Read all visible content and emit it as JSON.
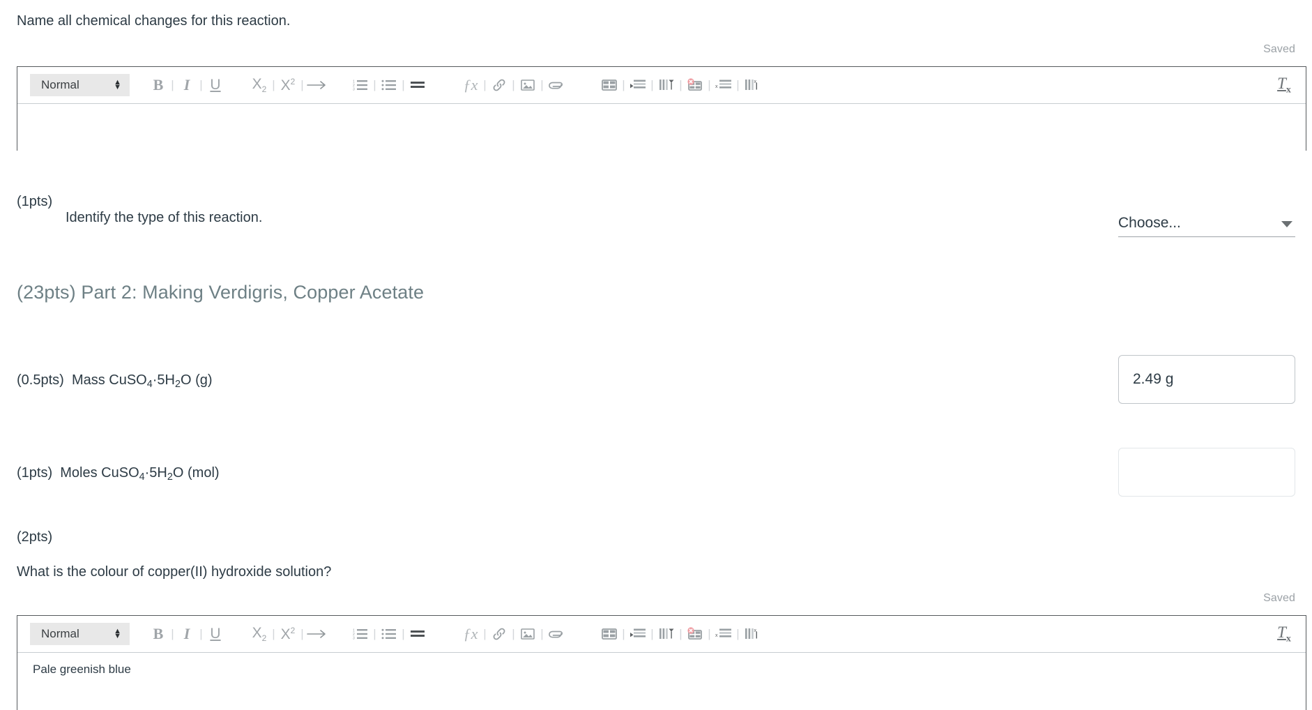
{
  "questions": {
    "q1": {
      "prompt": "Name all chemical changes for this reaction.",
      "saved_label": "Saved",
      "editor": {
        "format_value": "Normal",
        "body_text": ""
      }
    },
    "q2": {
      "points": "(1pts)",
      "prompt": "Identify the type of this reaction.",
      "dropdown_value": "Choose..."
    },
    "q3": {
      "points": "(0.5pts)",
      "label_prefix": "Mass CuSO",
      "label_sub1": "4",
      "label_mid": "·5H",
      "label_sub2": "2",
      "label_suffix": "O (g)",
      "value": "2.49 g"
    },
    "q4": {
      "points": "(1pts)",
      "label_prefix": "Moles CuSO",
      "label_sub1": "4",
      "label_mid": "·5H",
      "label_sub2": "2",
      "label_suffix": "O (mol)",
      "value": ""
    },
    "q5": {
      "points": "(2pts)",
      "prompt": "What is the colour of copper(II) hydroxide solution?",
      "saved_label": "Saved",
      "editor": {
        "format_value": "Normal",
        "body_text": "Pale greenish blue"
      }
    }
  },
  "section_heading": "(23pts) Part 2: Making Verdigris, Copper Acetate",
  "toolbar": {
    "format_value": "Normal",
    "bold": "B",
    "italic": "I",
    "underline": "U",
    "subscript_base": "X",
    "subscript_idx": "2",
    "superscript_base": "X",
    "superscript_idx": "2",
    "arrow": "→",
    "equation": "ƒx",
    "clear_formatting_base": "T",
    "clear_formatting_idx": "x",
    "separator": "|"
  },
  "colors": {
    "heading": "#6e8085",
    "text": "#2d3b45",
    "muted": "#9ba1a6",
    "editor_border": "#55595c",
    "icon": "#9aa0a4",
    "delete_accent": "#e8838a"
  }
}
